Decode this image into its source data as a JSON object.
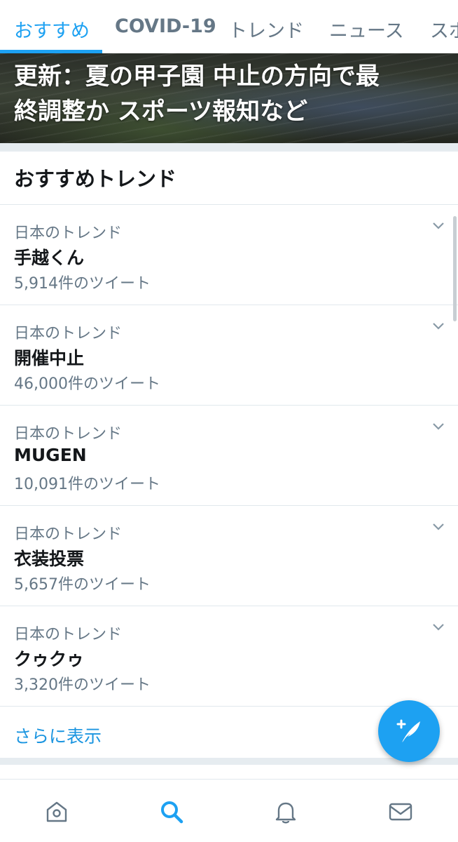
{
  "tabs": [
    {
      "label": "おすすめ",
      "active": true
    },
    {
      "label": "COVID-19",
      "active": false
    },
    {
      "label": "トレンド",
      "active": false
    },
    {
      "label": "ニュース",
      "active": false
    },
    {
      "label": "スポ",
      "active": false
    }
  ],
  "hero": {
    "title": "更新：夏の甲子園 中止の方向で最\n終調整か スポーツ報知など"
  },
  "trends_section": {
    "title": "おすすめトレンド",
    "items": [
      {
        "context": "日本のトレンド",
        "name": "手越くん",
        "count": "5,914件のツイート"
      },
      {
        "context": "日本のトレンド",
        "name": "開催中止",
        "count": "46,000件のツイート"
      },
      {
        "context": "日本のトレンド",
        "name": "MUGEN",
        "count": "10,091件のツイート"
      },
      {
        "context": "日本のトレンド",
        "name": "衣装投票",
        "count": "5,657件のツイート"
      },
      {
        "context": "日本のトレンド",
        "name": "クゥクゥ",
        "count": "3,320件のツイート"
      }
    ],
    "show_more": "さらに表示"
  },
  "icons": {
    "chevron": "chevron-down-icon",
    "fab": "compose-tweet-icon",
    "nav": [
      "home-icon",
      "search-icon",
      "notifications-icon",
      "messages-icon"
    ]
  },
  "colors": {
    "accent": "#1da1f2",
    "link": "#1b95e0",
    "secondary_text": "#657786",
    "primary_text": "#14171a",
    "divider": "#e1e8ed"
  }
}
